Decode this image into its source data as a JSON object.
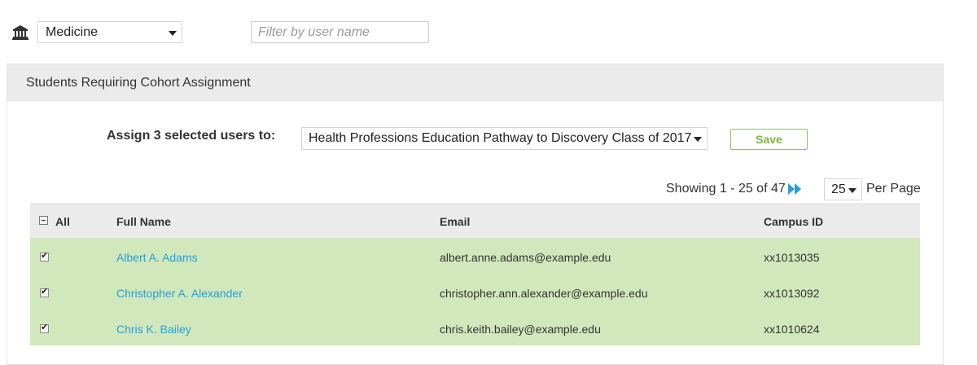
{
  "toolbar": {
    "school_icon": "institution-icon",
    "school_value": "Medicine",
    "filter_placeholder": "Filter by user name"
  },
  "panel": {
    "title": "Students Requiring Cohort Assignment",
    "assign_label": "Assign 3 selected users to:",
    "cohort_value": "Health Professions Education Pathway to Discovery Class of 2017",
    "save_label": "Save"
  },
  "pagination": {
    "showing": "Showing 1 - 25 of 47",
    "next_icon": "fast-forward-icon",
    "per_page_value": "25",
    "per_page_label": "Per Page"
  },
  "table": {
    "headers": {
      "all": "All",
      "full_name": "Full Name",
      "email": "Email",
      "campus_id": "Campus ID"
    },
    "rows": [
      {
        "checked": true,
        "name": "Albert A. Adams",
        "email": "albert.anne.adams@example.edu",
        "campus_id": "xx1013035"
      },
      {
        "checked": true,
        "name": "Christopher A. Alexander",
        "email": "christopher.ann.alexander@example.edu",
        "campus_id": "xx1013092"
      },
      {
        "checked": true,
        "name": "Chris K. Bailey",
        "email": "chris.keith.bailey@example.edu",
        "campus_id": "xx1010624"
      }
    ]
  },
  "colors": {
    "selected_row": "#d0e8bc",
    "link": "#2a9fd6",
    "save_green": "#7cb342",
    "header_bg": "#ebebeb"
  }
}
